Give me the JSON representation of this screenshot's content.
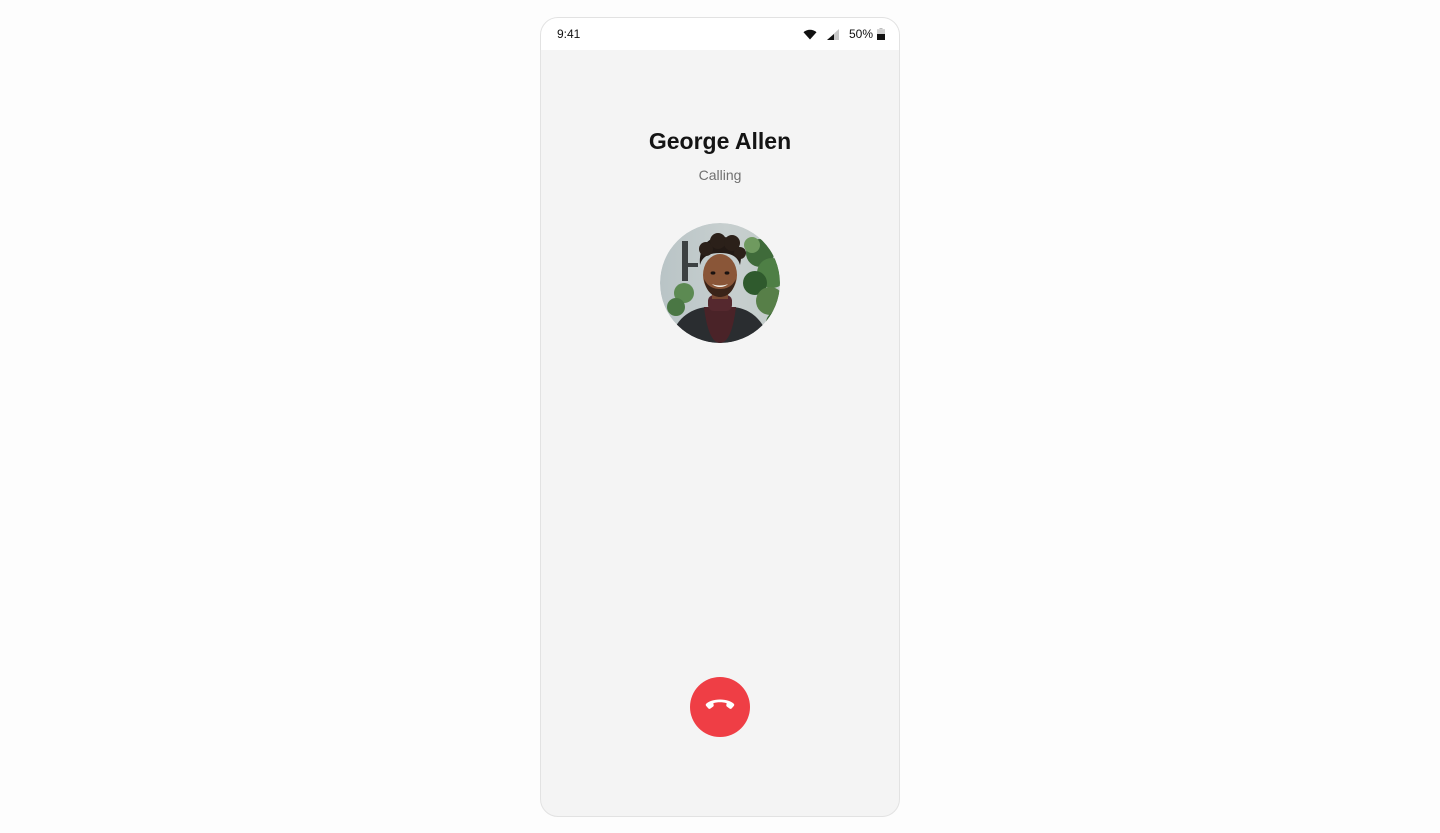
{
  "status_bar": {
    "time": "9:41",
    "battery_percent": "50%",
    "icons": [
      "wifi-icon",
      "signal-icon",
      "battery-icon"
    ]
  },
  "call": {
    "caller_name": "George Allen",
    "status": "Calling",
    "end_call_icon": "phone-hangup-icon"
  },
  "colors": {
    "screen_background": "#f4f4f4",
    "end_call_button": "#ef3e45"
  }
}
